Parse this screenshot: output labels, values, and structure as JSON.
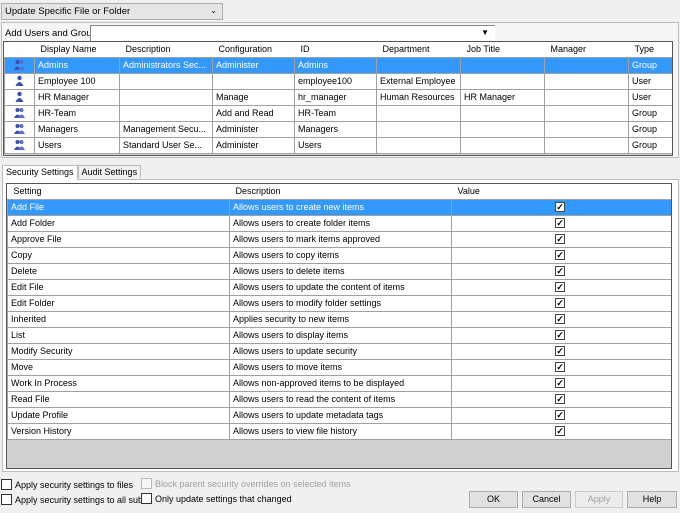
{
  "mode_select": {
    "value": "Update Specific File or Folder"
  },
  "users_group": {
    "label": "Add Users and Groups",
    "combo_value": ""
  },
  "users_table": {
    "columns": [
      "",
      "Display Name",
      "Description",
      "Configuration",
      "ID",
      "Department",
      "Job Title",
      "Manager",
      "Type"
    ],
    "rows": [
      {
        "icon": "group-icon",
        "name": "Admins",
        "desc": "Administrators Sec...",
        "config": "Administer",
        "id": "Admins",
        "dept": "",
        "job": "",
        "manager": "",
        "type": "Group",
        "selected": true
      },
      {
        "icon": "user-icon",
        "name": "Employee 100",
        "desc": "",
        "config": "",
        "id": "employee100",
        "dept": "External Employee",
        "job": "",
        "manager": "",
        "type": "User"
      },
      {
        "icon": "user-icon",
        "name": "HR Manager",
        "desc": "",
        "config": "Manage",
        "id": "hr_manager",
        "dept": "Human Resources",
        "job": "HR Manager",
        "manager": "",
        "type": "User"
      },
      {
        "icon": "group-icon",
        "name": "HR-Team",
        "desc": "",
        "config": "Add and Read",
        "id": "HR-Team",
        "dept": "",
        "job": "",
        "manager": "",
        "type": "Group"
      },
      {
        "icon": "group-icon",
        "name": "Managers",
        "desc": "Management Secu...",
        "config": "Administer",
        "id": "Managers",
        "dept": "",
        "job": "",
        "manager": "",
        "type": "Group"
      },
      {
        "icon": "group-icon",
        "name": "Users",
        "desc": "Standard User Se...",
        "config": "Administer",
        "id": "Users",
        "dept": "",
        "job": "",
        "manager": "",
        "type": "Group"
      }
    ]
  },
  "tabs": [
    {
      "label": "Security Settings",
      "active": true
    },
    {
      "label": "Audit Settings",
      "active": false
    }
  ],
  "settings_table": {
    "columns": [
      "Setting",
      "Description",
      "Value"
    ],
    "rows": [
      {
        "setting": "Add File",
        "desc": "Allows users to create new items",
        "value": true,
        "selected": true
      },
      {
        "setting": "Add Folder",
        "desc": "Allows users to create folder items",
        "value": true
      },
      {
        "setting": "Approve File",
        "desc": "Allows users to mark items approved",
        "value": true
      },
      {
        "setting": "Copy",
        "desc": "Allows users to copy items",
        "value": true
      },
      {
        "setting": "Delete",
        "desc": "Allows users to delete items",
        "value": true
      },
      {
        "setting": "Edit File",
        "desc": "Allows users to update the content of items",
        "value": true
      },
      {
        "setting": "Edit Folder",
        "desc": "Allows users to modify folder settings",
        "value": true
      },
      {
        "setting": "Inherited",
        "desc": "Applies security to new items",
        "value": true
      },
      {
        "setting": "List",
        "desc": "Allows users to display items",
        "value": true
      },
      {
        "setting": "Modify Security",
        "desc": "Allows users to update security",
        "value": true
      },
      {
        "setting": "Move",
        "desc": "Allows users to move items",
        "value": true
      },
      {
        "setting": "Work In Process",
        "desc": "Allows non-approved items to be displayed",
        "value": true
      },
      {
        "setting": "Read File",
        "desc": "Allows users to read the content of items",
        "value": true
      },
      {
        "setting": "Update Profile",
        "desc": "Allows users to update metadata tags",
        "value": true
      },
      {
        "setting": "Version History",
        "desc": "Allows users to view file history",
        "value": true
      }
    ]
  },
  "options": {
    "apply_files": {
      "label": "Apply security settings to files",
      "checked": false
    },
    "apply_sub": {
      "label": "Apply security settings to all sub",
      "checked": false
    },
    "block_parent": {
      "label": "Block parent security overrides on selected items",
      "checked": false,
      "disabled": true
    },
    "only_changed": {
      "label": "Only update settings that changed",
      "checked": false
    }
  },
  "buttons": {
    "ok": "OK",
    "cancel": "Cancel",
    "apply": "Apply",
    "help": "Help"
  },
  "colors": {
    "selection": "#3399ff",
    "icon": "#3a4fb0"
  }
}
